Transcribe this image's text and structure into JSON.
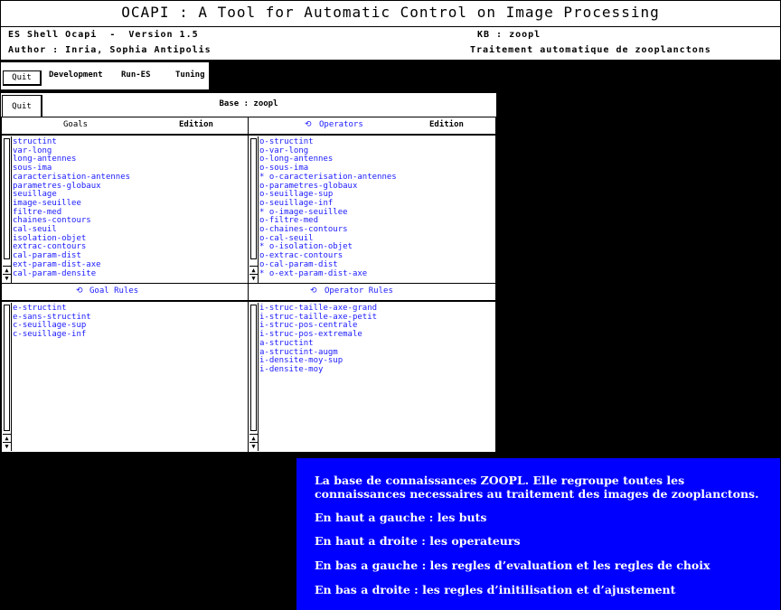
{
  "title": "OCAPI : A Tool for Automatic Control on Image Processing",
  "info": {
    "shell": "ES Shell Ocapi  -  Version 1.5",
    "kb": "KB : zoopl",
    "author": "Author : Inria, Sophia Antipolis",
    "description": "Traitement automatique de zooplanctons"
  },
  "menubar": {
    "quit": "Quit",
    "items": [
      "Development",
      "Run-ES",
      "Tuning"
    ]
  },
  "base": {
    "quit": "Quit",
    "title": "Base : zoopl"
  },
  "goals": {
    "header": "Goals",
    "edition": "Edition",
    "items": [
      "structint",
      "var-long",
      "long-antennes",
      "sous-ima",
      "caracterisation-antennes",
      "parametres-globaux",
      "seuillage",
      "image-seuillee",
      "filtre-med",
      "chaines-contours",
      "cal-seuil",
      "isolation-objet",
      "extrac-contours",
      "cal-param-dist",
      "ext-param-dist-axe",
      "cal-param-densite"
    ]
  },
  "operators": {
    "header": "Operators",
    "edition": "Edition",
    "icon": "cycle-icon",
    "items": [
      "o-structint",
      "o-var-long",
      "o-long-antennes",
      "o-sous-ima",
      "* o-caracterisation-antennes",
      "o-parametres-globaux",
      "o-seuillage-sup",
      "o-seuillage-inf",
      "* o-image-seuillee",
      "o-filtre-med",
      "o-chaines-contours",
      "o-cal-seuil",
      "* o-isolation-objet",
      "o-extrac-contours",
      "o-cal-param-dist",
      "* o-ext-param-dist-axe"
    ]
  },
  "goal_rules": {
    "header": "Goal Rules",
    "icon": "cycle-icon",
    "items": [
      "e-structint",
      "e-sans-structint",
      "c-seuillage-sup",
      "c-seuillage-inf"
    ]
  },
  "operator_rules": {
    "header": "Operator Rules",
    "icon": "cycle-icon",
    "items": [
      "i-struc-taille-axe-grand",
      "i-struc-taille-axe-petit",
      "i-struc-pos-centrale",
      "i-struc-pos-extremale",
      "a-structint",
      "a-structint-augm",
      "i-densite-moy-sup",
      "i-densite-moy"
    ]
  },
  "caption": {
    "p1": "La base de connaissances ZOOPL. Elle regroupe toutes les connaissances necessaires au traitement des images de zooplanctons.",
    "p2": "En haut a gauche : les buts",
    "p3": "En haut a droite : les operateurs",
    "p4": "En bas a gauche : les regles d’evaluation et les regles de choix",
    "p5": "En bas a droite : les regles d’initilisation et d’ajustement"
  },
  "colors": {
    "list_text": "#1a1aff",
    "caption_bg": "#0000ff",
    "background": "#000000"
  }
}
